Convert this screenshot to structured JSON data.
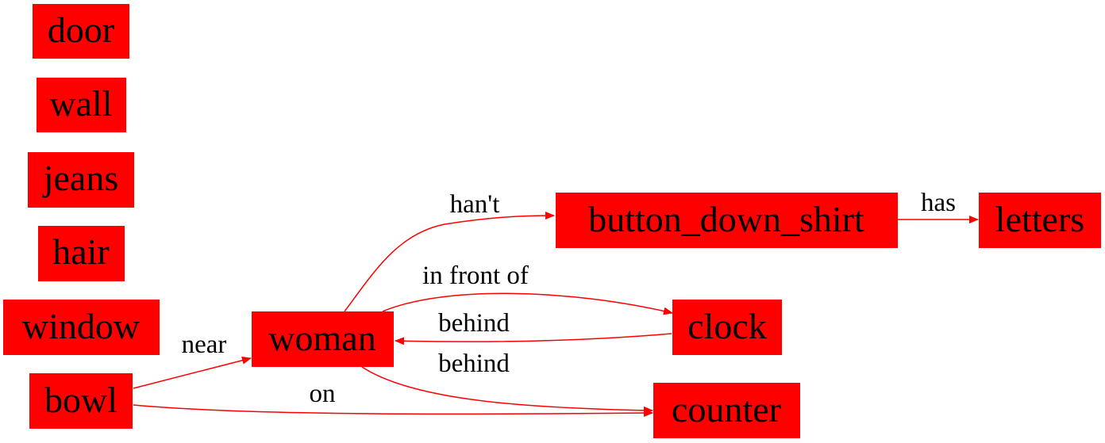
{
  "diagram": {
    "nodes": {
      "door": "door",
      "wall": "wall",
      "jeans": "jeans",
      "hair": "hair",
      "window": "window",
      "bowl": "bowl",
      "woman": "woman",
      "button_down_shirt": "button_down_shirt",
      "letters": "letters",
      "clock": "clock",
      "counter": "counter"
    },
    "edges": [
      {
        "from": "woman",
        "to": "button_down_shirt",
        "label": "han't"
      },
      {
        "from": "button_down_shirt",
        "to": "letters",
        "label": "has"
      },
      {
        "from": "woman",
        "to": "clock",
        "label": "in front of"
      },
      {
        "from": "clock",
        "to": "woman",
        "label": "behind"
      },
      {
        "from": "woman",
        "to": "counter",
        "label": "behind"
      },
      {
        "from": "bowl",
        "to": "woman",
        "label": "near"
      },
      {
        "from": "bowl",
        "to": "counter",
        "label": "on"
      }
    ],
    "colors": {
      "node_fill": "#ff0000",
      "edge": "#ff0000",
      "text": "#000000"
    }
  }
}
